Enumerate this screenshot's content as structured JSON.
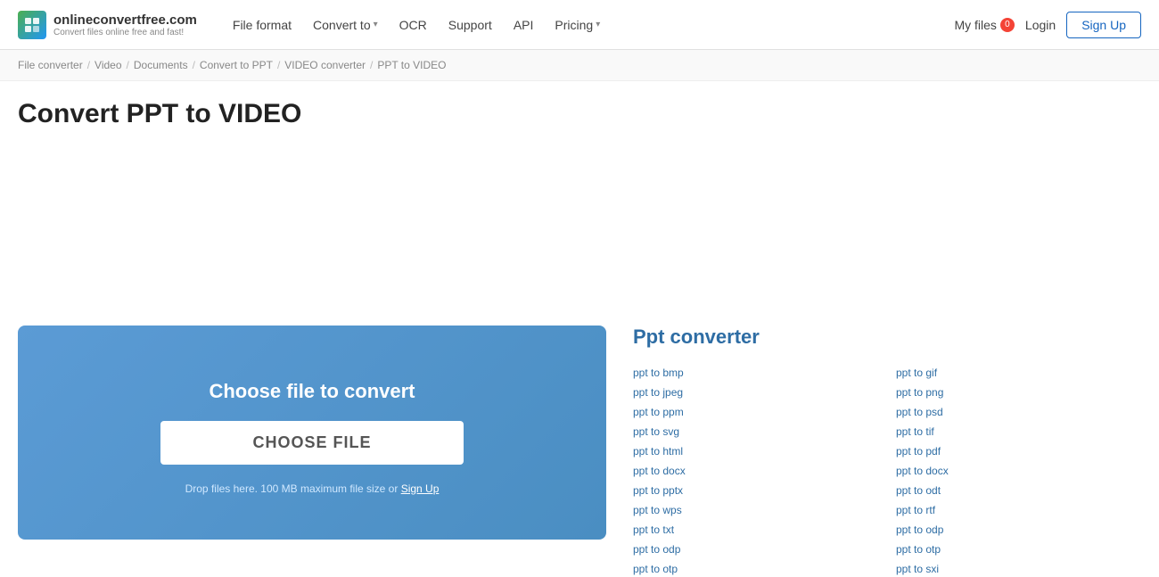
{
  "header": {
    "logo_name": "onlineconvertfree.com",
    "logo_sub": "Convert files online free and fast!",
    "nav": [
      {
        "label": "File format",
        "has_dropdown": false
      },
      {
        "label": "Convert to",
        "has_dropdown": true
      },
      {
        "label": "OCR",
        "has_dropdown": false
      },
      {
        "label": "Support",
        "has_dropdown": false
      },
      {
        "label": "API",
        "has_dropdown": false
      },
      {
        "label": "Pricing",
        "has_dropdown": true
      }
    ],
    "my_files_label": "My files",
    "my_files_badge": "0",
    "login_label": "Login",
    "signup_label": "Sign Up"
  },
  "breadcrumb": {
    "items": [
      {
        "label": "File converter"
      },
      {
        "label": "Video"
      },
      {
        "label": "Documents"
      },
      {
        "label": "Convert to PPT"
      },
      {
        "label": "VIDEO converter"
      },
      {
        "label": "PPT to VIDEO"
      }
    ]
  },
  "page": {
    "title": "Convert PPT to VIDEO"
  },
  "upload": {
    "title": "Choose file to convert",
    "button_label": "CHOOSE FILE",
    "drop_text": "Drop files here. 100 MB maximum file size or",
    "sign_up_link": "Sign Up"
  },
  "ppt_sidebar": {
    "title": "Ppt converter",
    "links": [
      "ppt to bmp",
      "ppt to gif",
      "ppt to jpeg",
      "ppt to png",
      "ppt to ppm",
      "ppt to psd",
      "ppt to svg",
      "ppt to tif",
      "ppt to html",
      "ppt to pdf",
      "ppt to docx",
      "ppt to docx",
      "ppt to pptx",
      "ppt to odt",
      "ppt to wps",
      "ppt to rtf",
      "ppt to txt",
      "ppt to odp",
      "ppt to odp",
      "ppt to otp",
      "ppt to otp",
      "ppt to sxi"
    ]
  }
}
